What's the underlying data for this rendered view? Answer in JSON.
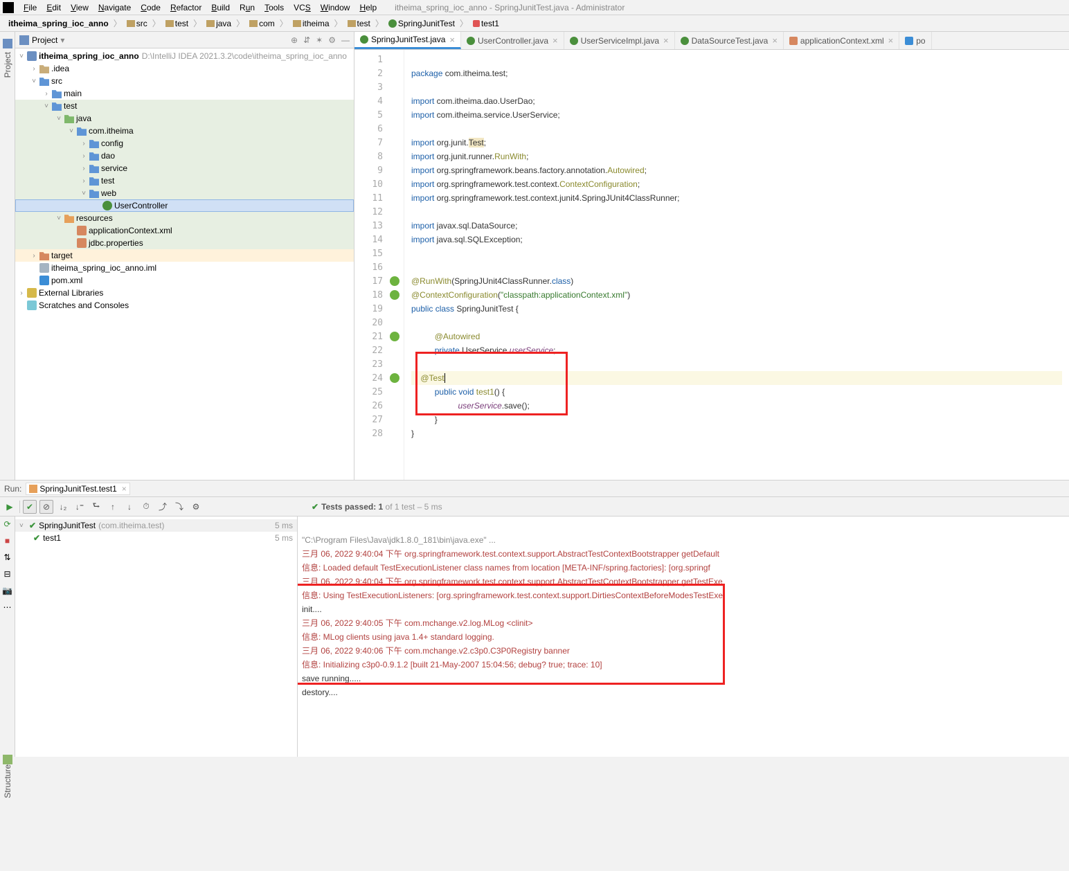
{
  "window": {
    "title": "itheima_spring_ioc_anno - SpringJunitTest.java - Administrator"
  },
  "menu": [
    "File",
    "Edit",
    "View",
    "Navigate",
    "Code",
    "Refactor",
    "Build",
    "Run",
    "Tools",
    "VCS",
    "Window",
    "Help"
  ],
  "breadcrumb": [
    "itheima_spring_ioc_anno",
    "src",
    "test",
    "java",
    "com",
    "itheima",
    "test",
    "SpringJunitTest",
    "test1"
  ],
  "project_panel": {
    "title": "Project"
  },
  "tree": {
    "root": "itheima_spring_ioc_anno",
    "root_path": "D:\\IntelliJ IDEA 2021.3.2\\code\\itheima_spring_ioc_anno",
    "idea": ".idea",
    "src": "src",
    "main": "main",
    "test": "test",
    "java": "java",
    "com_itheima": "com.itheima",
    "config": "config",
    "dao": "dao",
    "service": "service",
    "pkg_test": "test",
    "web": "web",
    "UserController": "UserController",
    "resources": "resources",
    "appctx": "applicationContext.xml",
    "jdbc": "jdbc.properties",
    "target": "target",
    "iml": "itheima_spring_ioc_anno.iml",
    "pom": "pom.xml",
    "extlib": "External Libraries",
    "scratches": "Scratches and Consoles"
  },
  "tabs": [
    {
      "label": "SpringJunitTest.java",
      "active": true,
      "icon": "class"
    },
    {
      "label": "UserController.java",
      "active": false,
      "icon": "class"
    },
    {
      "label": "UserServiceImpl.java",
      "active": false,
      "icon": "class"
    },
    {
      "label": "DataSourceTest.java",
      "active": false,
      "icon": "class"
    },
    {
      "label": "applicationContext.xml",
      "active": false,
      "icon": "xml"
    },
    {
      "label": "po",
      "active": false,
      "icon": "m"
    }
  ],
  "code": {
    "l1_kw": "package",
    "l1_txt": " com.itheima.test;",
    "l3_kw": "import",
    "l3_txt": " com.itheima.dao.UserDao;",
    "l4_kw": "import",
    "l4_txt": " com.itheima.service.UserService;",
    "l6_kw": "import",
    "l6_a": " org.junit.",
    "l6_b": "Test",
    "l6_c": ";",
    "l7_kw": "import",
    "l7_a": " org.junit.runner.",
    "l7_b": "RunWith",
    "l7_c": ";",
    "l8_kw": "import",
    "l8_a": " org.springframework.beans.factory.annotation.",
    "l8_b": "Autowired",
    "l8_c": ";",
    "l9_kw": "import",
    "l9_a": " org.springframework.test.context.",
    "l9_b": "ContextConfiguration",
    "l9_c": ";",
    "l10_kw": "import",
    "l10_txt": " org.springframework.test.context.junit4.SpringJUnit4ClassRunner;",
    "l12_kw": "import",
    "l12_txt": " javax.sql.DataSource;",
    "l13_kw": "import",
    "l13_txt": " java.sql.SQLException;",
    "l16_a": "@RunWith",
    "l16_b": "(SpringJUnit4ClassRunner.",
    "l16_c": "class",
    "l16_d": ")",
    "l17_a": "@ContextConfiguration",
    "l17_b": "(",
    "l17_c": "\"classpath:applicationContext.xml\"",
    "l17_d": ")",
    "l18_a": "public class ",
    "l18_b": "SpringJunitTest {",
    "l20_a": "@Autowired",
    "l21_a": "private ",
    "l21_b": "UserService ",
    "l21_c": "userService",
    "l21_d": ";",
    "l23_a": "@Test",
    "l24_a": "public void ",
    "l24_b": "test1",
    "l24_c": "() {",
    "l25_a": "userService",
    "l25_b": ".save();",
    "l26_a": "}",
    "l27_a": "}"
  },
  "run": {
    "label": "Run:",
    "config": "SpringJunitTest.test1",
    "passed_pre": "Tests passed: 1",
    "passed_post": " of 1 test – 5 ms",
    "tree_root": "SpringJunitTest",
    "tree_root_sub": "(com.itheima.test)",
    "tree_root_time": "5 ms",
    "tree_child": "test1",
    "tree_child_time": "5 ms"
  },
  "console": {
    "l1": "\"C:\\Program Files\\Java\\jdk1.8.0_181\\bin\\java.exe\" ...",
    "l2": "三月 06, 2022 9:40:04 下午 org.springframework.test.context.support.AbstractTestContextBootstrapper getDefault",
    "l3": "信息: Loaded default TestExecutionListener class names from location [META-INF/spring.factories]: [org.springf",
    "l4": "三月 06, 2022 9:40:04 下午 org.springframework.test.context.support.AbstractTestContextBootstrapper getTestExe",
    "l5": "信息: Using TestExecutionListeners: [org.springframework.test.context.support.DirtiesContextBeforeModesTestExe",
    "l6": "init....",
    "l7": "三月 06, 2022 9:40:05 下午 com.mchange.v2.log.MLog <clinit>",
    "l8": "信息: MLog clients using java 1.4+ standard logging.",
    "l9": "三月 06, 2022 9:40:06 下午 com.mchange.v2.c3p0.C3P0Registry banner",
    "l10": "信息: Initializing c3p0-0.9.1.2 [built 21-May-2007 15:04:56; debug? true; trace: 10]",
    "l11": "save running.....",
    "l12": "destory...."
  },
  "sidebar": {
    "project": "Project",
    "structure": "Structure"
  }
}
